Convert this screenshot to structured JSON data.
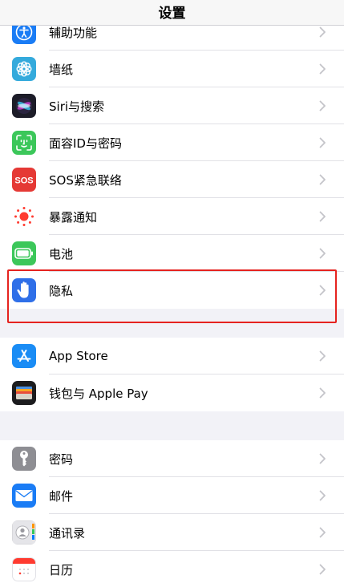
{
  "nav": {
    "title": "设置"
  },
  "group1": [
    {
      "label": "辅助功能",
      "icon": "accessibility-icon",
      "color": "#1a7cf5"
    },
    {
      "label": "墙纸",
      "icon": "wallpaper-flower-icon",
      "color": "#34aadc"
    },
    {
      "label": "Siri与搜索",
      "icon": "siri-icon",
      "color": "#1c1c28"
    },
    {
      "label": "面容ID与密码",
      "icon": "face-id-icon",
      "color": "#3cc75a"
    },
    {
      "label": "SOS紧急联络",
      "icon": "sos-icon",
      "color": "#e53935"
    },
    {
      "label": "暴露通知",
      "icon": "exposure-notification-icon",
      "color": "#ffffff"
    },
    {
      "label": "电池",
      "icon": "battery-icon",
      "color": "#3cc75a"
    },
    {
      "label": "隐私",
      "icon": "privacy-hand-icon",
      "color": "#2f6fe8"
    }
  ],
  "group2": [
    {
      "label": "App Store",
      "icon": "app-store-icon",
      "color": "#1a8cf5"
    },
    {
      "label": "钱包与 Apple Pay",
      "icon": "wallet-icon",
      "color": "#1c1c1e"
    }
  ],
  "group3": [
    {
      "label": "密码",
      "icon": "key-icon",
      "color": "#8e8e93"
    },
    {
      "label": "邮件",
      "icon": "mail-icon",
      "color": "#1a7cf5"
    },
    {
      "label": "通讯录",
      "icon": "contacts-icon",
      "color": "#d8d8dc"
    },
    {
      "label": "日历",
      "icon": "calendar-icon",
      "color": "#ffffff"
    }
  ],
  "highlight": {
    "color": "#e5231f"
  }
}
